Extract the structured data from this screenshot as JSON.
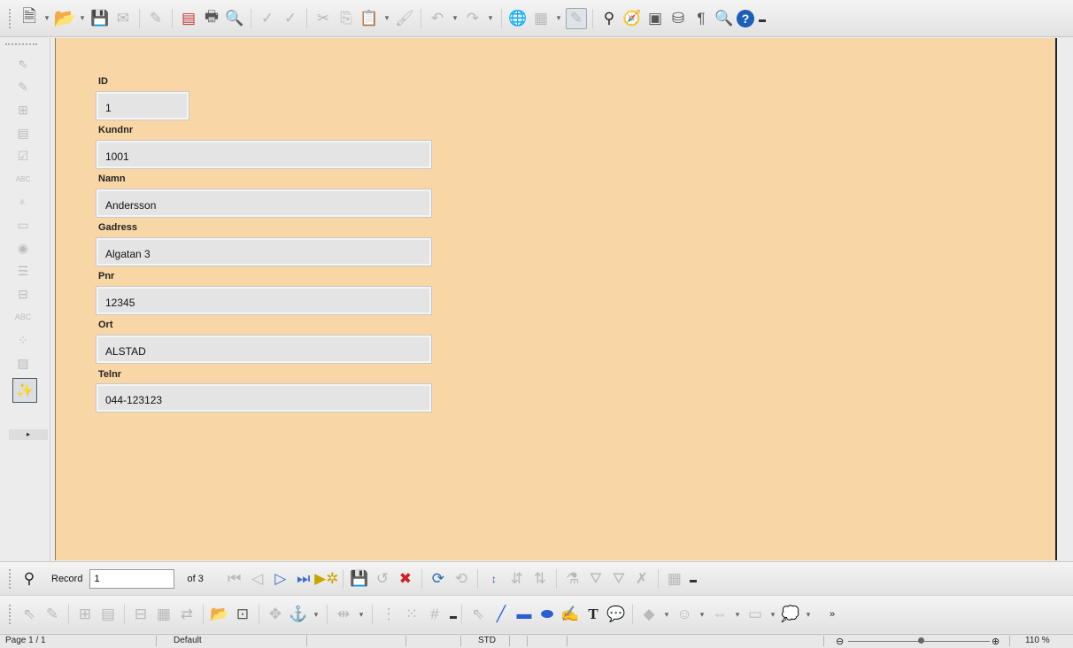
{
  "form": {
    "fields": [
      {
        "label": "ID",
        "value": "1"
      },
      {
        "label": "Kundnr",
        "value": "1001"
      },
      {
        "label": "Namn",
        "value": "Andersson"
      },
      {
        "label": "Gadress",
        "value": "Algatan 3"
      },
      {
        "label": "Pnr",
        "value": "12345"
      },
      {
        "label": "Ort",
        "value": "ALSTAD"
      },
      {
        "label": "Telnr",
        "value": "044-123123"
      }
    ]
  },
  "nav": {
    "record_label": "Record",
    "record_value": "1",
    "of_label": "of 3"
  },
  "status": {
    "page": "Page 1 / 1",
    "style": "Default",
    "mode": "STD",
    "zoom": "110 %"
  },
  "colors": {
    "canvas_bg": "#f8d6a5",
    "field_bg": "#e4e4e4"
  }
}
